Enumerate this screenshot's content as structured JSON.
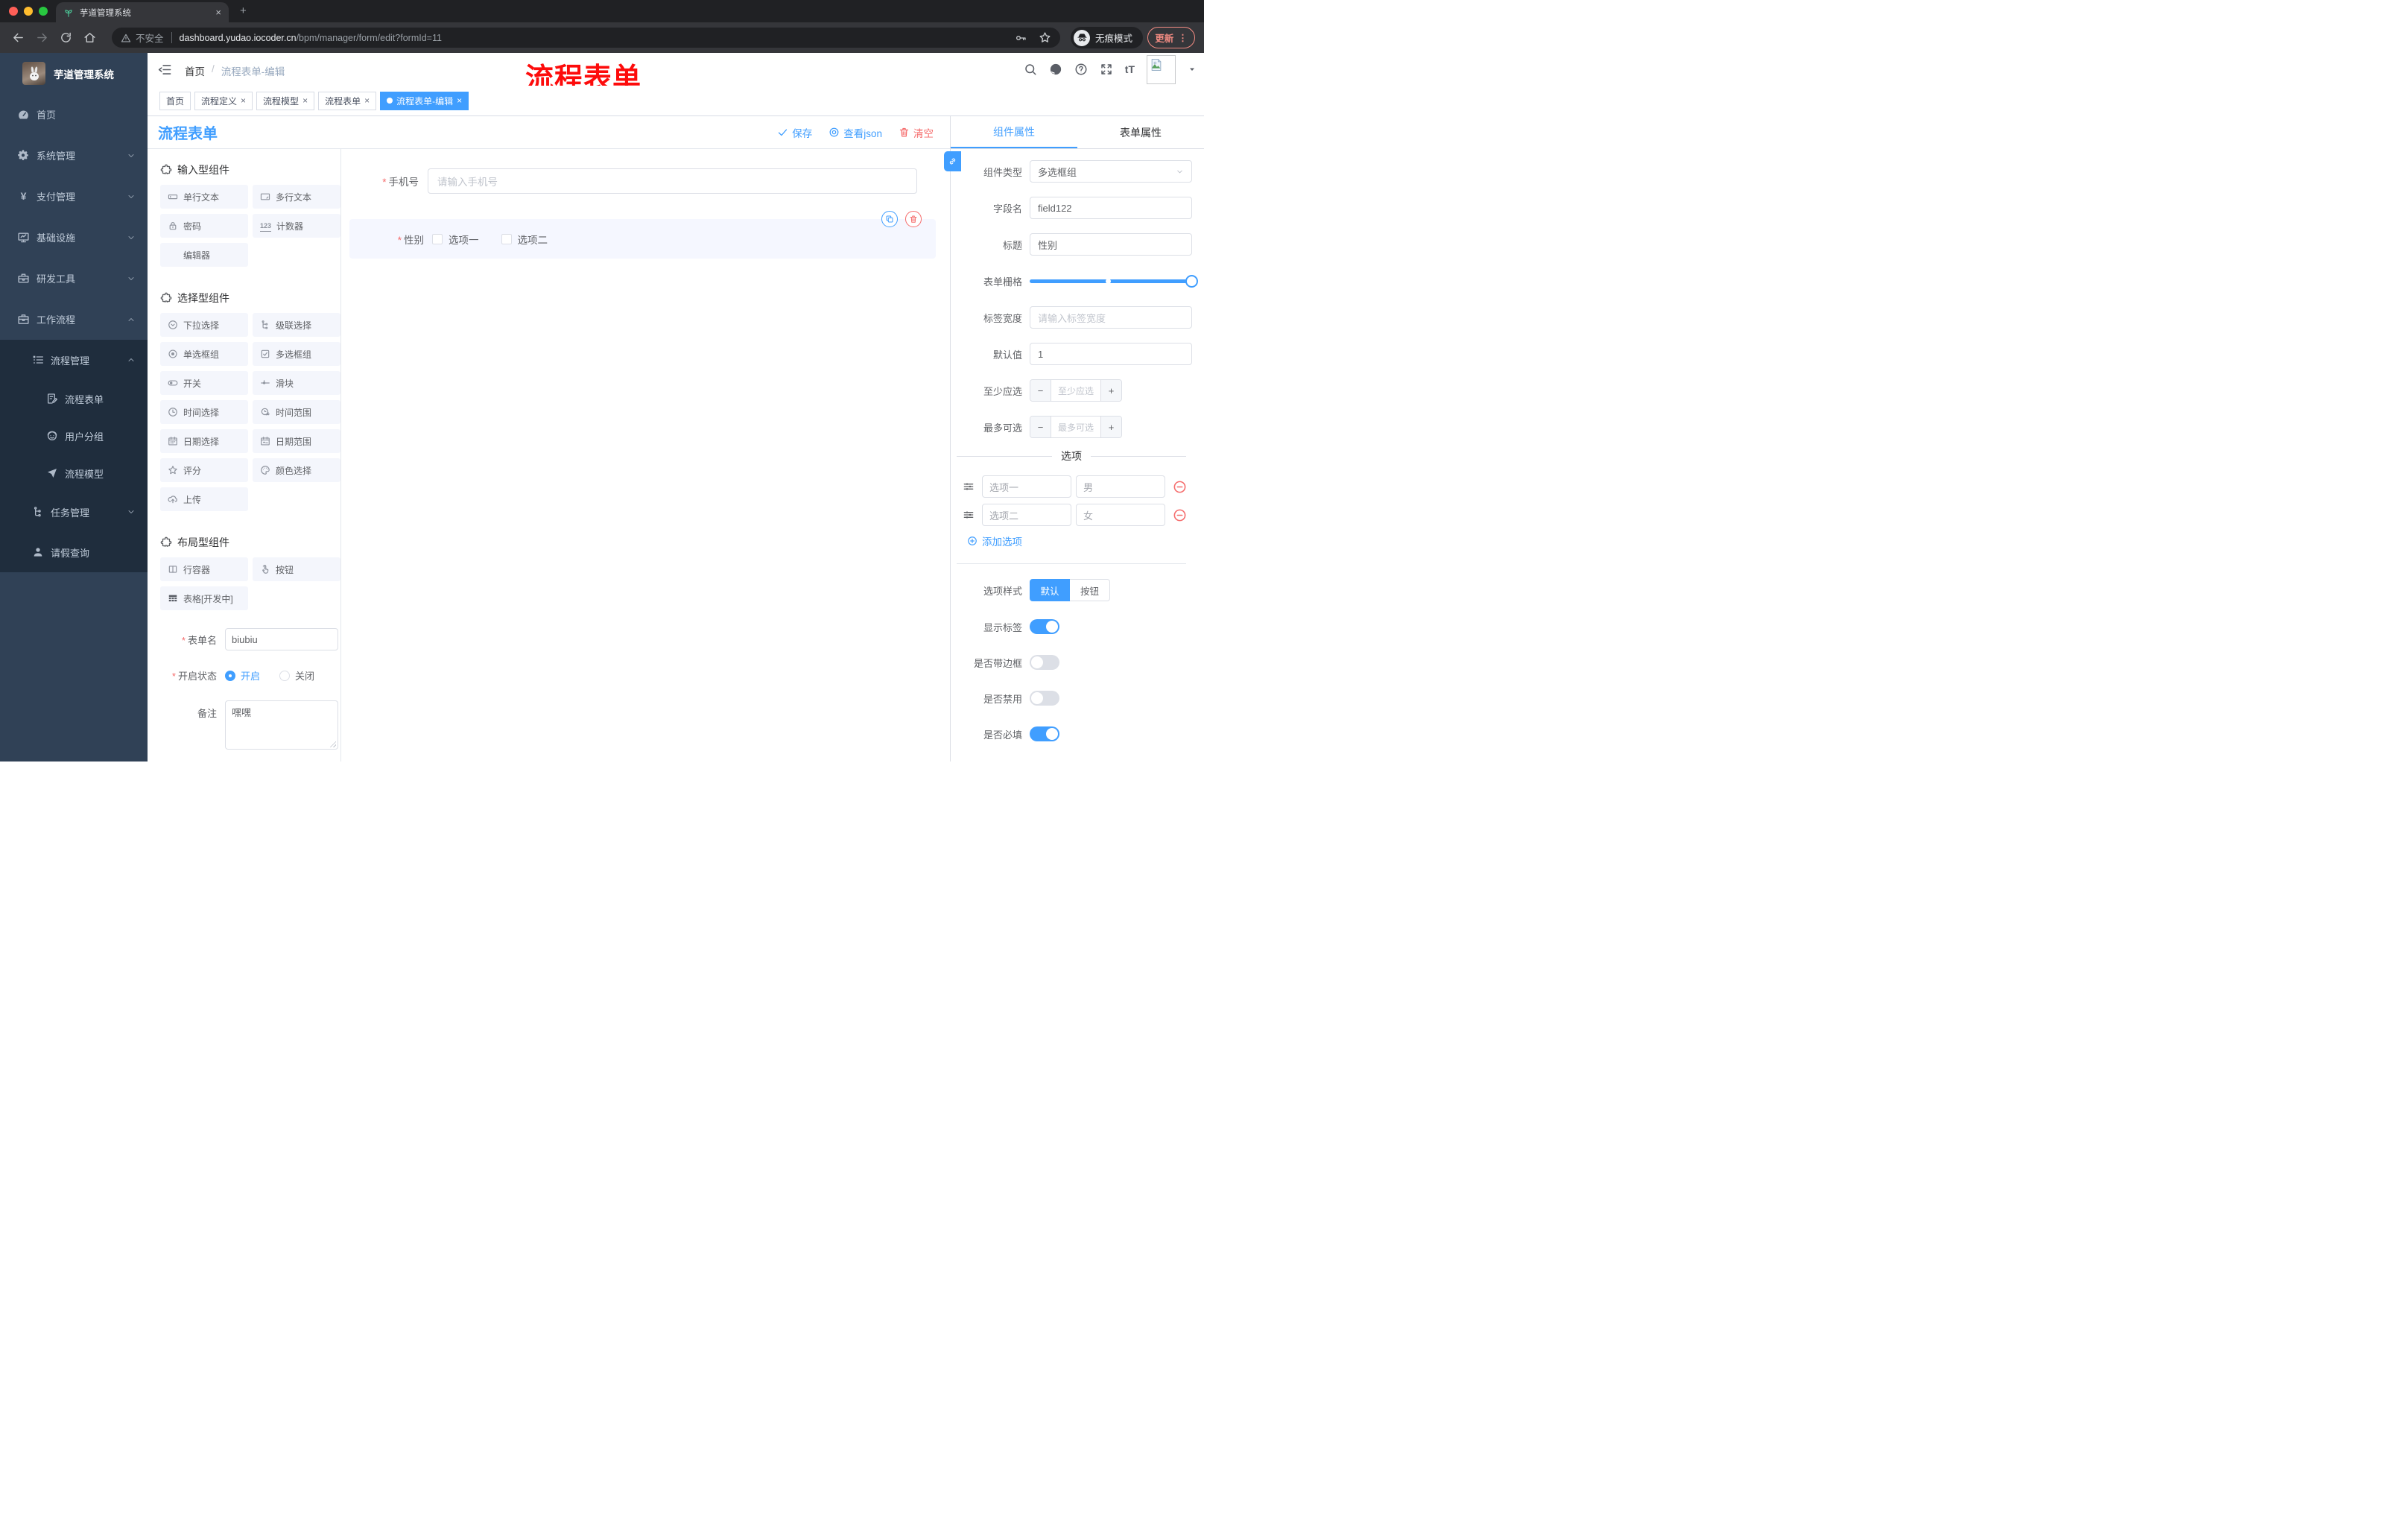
{
  "browser": {
    "tab_title": "芋道管理系统",
    "security_label": "不安全",
    "url_domain": "dashboard.yudao.iocoder.cn",
    "url_path": "/bpm/manager/form/edit?formId=11",
    "incognito_label": "无痕模式",
    "update_label": "更新"
  },
  "sidebar": {
    "app_title": "芋道管理系统",
    "items": [
      "首页",
      "系统管理",
      "支付管理",
      "基础设施",
      "研发工具",
      "工作流程"
    ],
    "sub_items": [
      "流程管理",
      "流程表单",
      "用户分组",
      "流程模型",
      "任务管理",
      "请假查询"
    ]
  },
  "header": {
    "breadcrumb_home": "首页",
    "breadcrumb_current": "流程表单-编辑",
    "annotation": "流程表单"
  },
  "tags": [
    "首页",
    "流程定义",
    "流程模型",
    "流程表单",
    "流程表单-编辑"
  ],
  "designer": {
    "title": "流程表单",
    "save": "保存",
    "view_json": "查看json",
    "clear": "清空",
    "sections": [
      {
        "title": "输入型组件",
        "items": [
          "单行文本",
          "多行文本",
          "密码",
          "计数器",
          "编辑器"
        ]
      },
      {
        "title": "选择型组件",
        "items": [
          "下拉选择",
          "级联选择",
          "单选框组",
          "多选框组",
          "开关",
          "滑块",
          "时间选择",
          "时间范围",
          "日期选择",
          "日期范围",
          "评分",
          "颜色选择",
          "上传"
        ]
      },
      {
        "title": "布局型组件",
        "items": [
          "行容器",
          "按钮",
          "表格[开发中]"
        ]
      }
    ],
    "form_name_label": "表单名",
    "form_name_value": "biubiu",
    "status_label": "开启状态",
    "status_on": "开启",
    "status_off": "关闭",
    "remark_label": "备注",
    "remark_value": "嘿嘿"
  },
  "canvas": {
    "phone_label": "手机号",
    "phone_placeholder": "请输入手机号",
    "gender_label": "性别",
    "gender_option1": "选项一",
    "gender_option2": "选项二"
  },
  "props": {
    "tab_component": "组件属性",
    "tab_form": "表单属性",
    "type_label": "组件类型",
    "type_value": "多选框组",
    "field_label": "字段名",
    "field_value": "field122",
    "title_label": "标题",
    "title_value": "性别",
    "grid_label": "表单栅格",
    "width_label": "标签宽度",
    "width_placeholder": "请输入标签宽度",
    "default_label": "默认值",
    "default_value": "1",
    "min_label": "至少应选",
    "min_placeholder": "至少应选",
    "max_label": "最多可选",
    "max_placeholder": "最多可选",
    "options_title": "选项",
    "options": [
      {
        "label": "选项一",
        "value": "男"
      },
      {
        "label": "选项二",
        "value": "女"
      }
    ],
    "add_option": "添加选项",
    "style_label": "选项样式",
    "style_default": "默认",
    "style_button": "按钮",
    "show_tag_label": "显示标签",
    "border_label": "是否带边框",
    "disabled_label": "是否禁用",
    "required_label": "是否必填"
  },
  "glyphs": {
    "close": "×",
    "plus": "+",
    "minus": "−",
    "dots": "⋮",
    "caret": "▾",
    "slash": "/",
    "counter": "123",
    "yen": "¥",
    "text_size": "tT",
    "asterisk": "*",
    "new_tab": "+"
  },
  "colors": {
    "accent": "#409eff",
    "danger": "#f56c6c",
    "annotation": "#ff0000",
    "sidebar_bg": "#304156",
    "submenu_bg": "#1f2d3d"
  }
}
